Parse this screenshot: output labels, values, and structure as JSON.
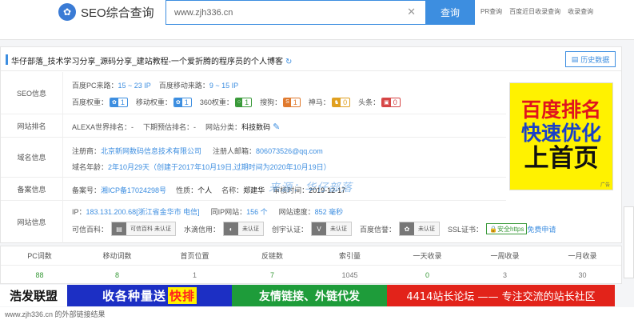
{
  "header": {
    "logo_text": "SEO综合查询",
    "search_value": "www.zjh336.cn",
    "search_button": "查询",
    "links": [
      "PR查询",
      "百度近日收录查询",
      "收录查询"
    ]
  },
  "site": {
    "title": "华仔部落_技术学习分享_源码分享_建站教程-一个爱折腾的程序员的个人博客",
    "history_button": "历史数据"
  },
  "seo": {
    "label": "SEO信息",
    "pc_source_label": "百度PC来路：",
    "pc_source_value": "15 ~ 23 IP",
    "mobile_source_label": "百度移动来路：",
    "mobile_source_value": "9 ~ 15 IP",
    "baidu_weight_label": "百度权重：",
    "baidu_weight": "1",
    "mobile_weight_label": "移动权重：",
    "mobile_weight": "1",
    "weight_360_label": "360权重：",
    "weight_360": "1",
    "sogou_label": "搜狗：",
    "sogou": "1",
    "shenma_label": "神马：",
    "shenma": "0",
    "toutiao_label": "头条：",
    "toutiao": "0"
  },
  "rank": {
    "label": "网站排名",
    "alexa_label": "ALEXA世界排名：",
    "alexa_value": "-",
    "forecast_label": "下期预估排名：",
    "forecast_value": "-",
    "category_label": "网站分类：",
    "category_value": "科技数码"
  },
  "domain": {
    "label": "域名信息",
    "registrar_label": "注册商：",
    "registrar_value": "北京新网数码信息技术有限公司",
    "email_label": "注册人邮箱：",
    "email_value": "806073526@qq.com",
    "age_label": "域名年龄：",
    "age_value": "2年10月29天（创建于2017年10月19日,过期时间为2020年10月19日）"
  },
  "icp": {
    "label": "备案信息",
    "number_label": "备案号：",
    "number_value": "湘ICP备17024298号",
    "nature_label": "性质：",
    "nature_value": "个人",
    "name_label": "名称：",
    "name_value": "郑建华",
    "time_label": "审核时间：",
    "time_value": "2019-12-17"
  },
  "server": {
    "label": "网站信息",
    "ip_label": "IP：",
    "ip_value": "183.131.200.68[浙江省金华市 电信]",
    "same_ip_label": "同IP网站：",
    "same_ip_value": "156 个",
    "speed_label": "网站速度：",
    "speed_value": "852 毫秒",
    "baike_label": "可信百科：",
    "baike_badge": "可信百科 未认证",
    "shuiyu_label": "水滴信用：",
    "shuiyu_badge": "未认证",
    "chuangyu_label": "创宇认证：",
    "chuangyu_badge": "未认证",
    "baidu_credit_label": "百度信誉：",
    "baidu_credit_badge": "未认证",
    "ssl_label": "SSL证书：",
    "ssl_badge": "安全https",
    "ssl_link": "免费申请"
  },
  "ad_right": {
    "line1": "百度排名",
    "line2": "快速优化",
    "line3": "上首页",
    "tag": "广告"
  },
  "watermark": "来源：华仔部落",
  "stats": {
    "headers": [
      "PC词数",
      "移动词数",
      "首页位置",
      "反链数",
      "索引量",
      "一天收录",
      "一周收录",
      "一月收录"
    ],
    "values": [
      "88",
      "8",
      "1",
      "7",
      "1045",
      "0",
      "3",
      "30"
    ],
    "colors": [
      "#3a9a3a",
      "#3a9a3a",
      "#777777",
      "#3a9a3a",
      "#777777",
      "#3a9a3a",
      "#777777",
      "#777777"
    ]
  },
  "banners": {
    "b1": "浩发联盟",
    "b2a": "收各种量送",
    "b2b": "快排",
    "b3": "友情链接、外链代发",
    "b4": "4414站长论坛 —— 专注交流的站长社区"
  },
  "bottom_text": "www.zjh336.cn  的外部链接结果"
}
